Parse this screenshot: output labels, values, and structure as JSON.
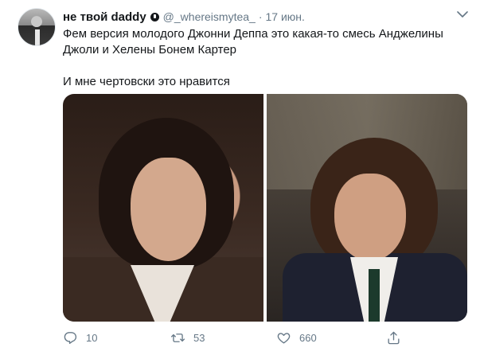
{
  "tweet": {
    "display_name": "не твой daddy",
    "handle": "@_whereismytea_",
    "separator": "·",
    "time": "17 июн.",
    "text_line1": "Фем версия молодого Джонни Деппа это какая-то смесь Анджелины Джоли и Хелены Бонем Картер",
    "text_line2": "И мне чертовски это нравится"
  },
  "actions": {
    "reply_count": "10",
    "retweet_count": "53",
    "like_count": "660"
  },
  "icons": {
    "verified": "verified-badge-icon",
    "caret": "chevron-down-icon",
    "reply": "reply-icon",
    "retweet": "retweet-icon",
    "like": "heart-icon",
    "share": "share-icon"
  },
  "colors": {
    "text": "#14171a",
    "secondary": "#657786",
    "background": "#ffffff"
  }
}
